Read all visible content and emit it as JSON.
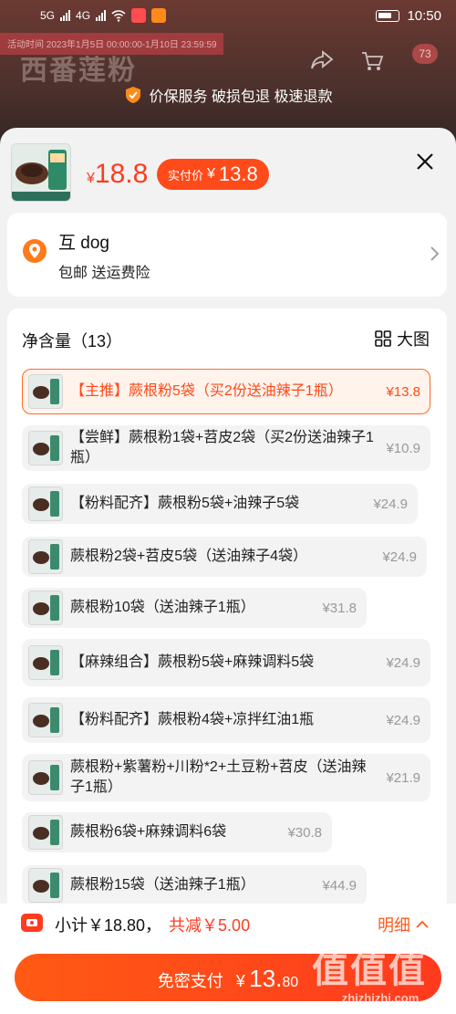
{
  "status_bar": {
    "network": "5G",
    "network2": "4G",
    "time": "10:50"
  },
  "background": {
    "time_text": "活动时间 2023年1月5日 00:00:00-1月10日 23:59:59",
    "title_faded": "西番莲粉",
    "cart_count": "73",
    "service_text": "价保服务 破损包退 极速退款"
  },
  "header": {
    "price_currency": "¥",
    "price": "18.8",
    "real_label": "实付价",
    "real_currency": "¥",
    "real_price": "13.8"
  },
  "shop": {
    "name": "互 dog",
    "subtitle": "包邮  送运费险"
  },
  "spec": {
    "title": "净含量（13）",
    "big_view": "大图",
    "options": [
      {
        "label": "【主推】蕨根粉5袋（买2份送油辣子1瓶）",
        "price": "¥13.8",
        "selected": true
      },
      {
        "label": "【尝鲜】蕨根粉1袋+苕皮2袋（买2份送油辣子1瓶）",
        "price": "¥10.9",
        "selected": false
      },
      {
        "label": "【粉料配齐】蕨根粉5袋+油辣子5袋",
        "price": "¥24.9",
        "selected": false
      },
      {
        "label": "蕨根粉2袋+苕皮5袋（送油辣子4袋）",
        "price": "¥24.9",
        "selected": false
      },
      {
        "label": "蕨根粉10袋（送油辣子1瓶）",
        "price": "¥31.8",
        "selected": false
      },
      {
        "label": "【麻辣组合】蕨根粉5袋+麻辣调料5袋",
        "price": "¥24.9",
        "selected": false
      },
      {
        "label": "【粉料配齐】蕨根粉4袋+凉拌红油1瓶",
        "price": "¥24.9",
        "selected": false
      },
      {
        "label": "蕨根粉+紫薯粉+川粉*2+土豆粉+苕皮（送油辣子1瓶）",
        "price": "¥21.9",
        "selected": false
      },
      {
        "label": "蕨根粉6袋+麻辣调料6袋",
        "price": "¥30.8",
        "selected": false
      },
      {
        "label": "蕨根粉15袋（送油辣子1瓶）",
        "price": "¥44.9",
        "selected": false
      }
    ]
  },
  "bottom": {
    "subtotal": "小计￥18.80，",
    "discount": "共减￥5.00",
    "detail": "明细",
    "pay_label": "免密支付",
    "pay_currency": "¥",
    "pay_int": "13.",
    "pay_dec": "80"
  },
  "watermark": {
    "text": "值值值",
    "url": "zhizhizhi.com"
  },
  "colors": {
    "accent": "#ff4a1a",
    "selected_bg": "#fff3ec",
    "sheet_bg": "#f2f2f2"
  }
}
